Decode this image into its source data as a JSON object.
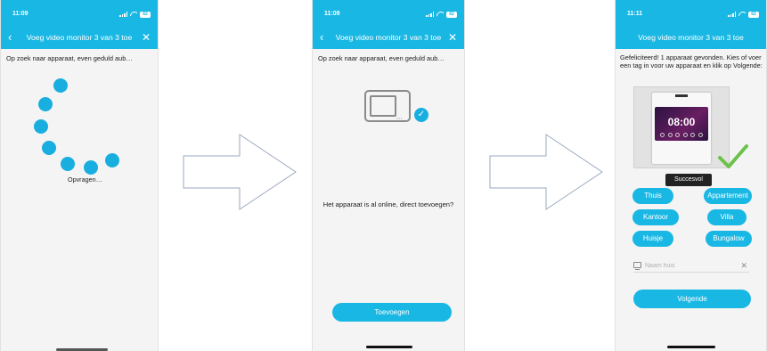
{
  "phone1": {
    "time": "11:09",
    "battery": "62",
    "title": "Voeg video monitor 3 van 3 toe",
    "message": "Op zoek naar apparaat, even geduld aub…",
    "loading_label": "Opvragen…"
  },
  "phone2": {
    "time": "11:09",
    "battery": "62",
    "title": "Voeg video monitor 3 van 3 toe",
    "message": "Op zoek naar apparaat, even geduld aub…",
    "online_text": "Het apparaat is al online, direct toevoegen?",
    "add_button": "Toevoegen"
  },
  "phone3": {
    "time": "11:11",
    "battery": "62",
    "title": "Voeg video monitor 3 van 3 toe",
    "message": "Gefeliciteerd! 1 apparaat gevonden. Kies of voer een tag in voor uw apparaat en klik op Volgende:",
    "device_time": "08:00",
    "success_label": "Succesvol",
    "tags": [
      "Thuis",
      "Appartement",
      "Kantoor",
      "Villa",
      "Huisje",
      "Bungalow"
    ],
    "name_placeholder": "Naam huis",
    "next_button": "Volgende"
  },
  "colors": {
    "accent": "#19b8e4",
    "success_green": "#6cc24a",
    "background": "#f4f4f4"
  },
  "icons": {
    "back": "chevron-left-icon",
    "close": "close-icon",
    "check": "check-icon",
    "monitor": "monitor-icon",
    "flow_arrow": "arrow-right-icon"
  }
}
